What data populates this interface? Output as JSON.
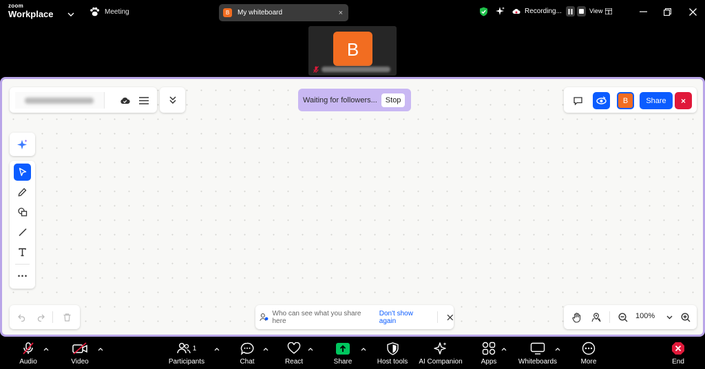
{
  "titlebar": {
    "logo_small": "zoom",
    "logo_main": "Workplace",
    "meeting_label": "Meeting",
    "whiteboard_tab": {
      "avatar": "B",
      "title": "My whiteboard",
      "close": "×"
    },
    "recording_label": "Recording...",
    "view_label": "View"
  },
  "video_tile": {
    "avatar_letter": "B"
  },
  "whiteboard": {
    "follow_status": "Waiting for followers...",
    "stop_label": "Stop",
    "share_label": "Share",
    "close_label": "×",
    "user_avatar": "B",
    "notice_text": "Who can see what you share here",
    "notice_link": "Don't show again",
    "zoom_level": "100%"
  },
  "toolbar": {
    "audio": "Audio",
    "video": "Video",
    "participants": "Participants",
    "participants_count": "1",
    "chat": "Chat",
    "react": "React",
    "share": "Share",
    "host_tools": "Host tools",
    "ai_companion": "AI Companion",
    "apps": "Apps",
    "whiteboards": "Whiteboards",
    "more": "More",
    "end": "End"
  },
  "colors": {
    "accent": "#0b5cff",
    "avatar_orange": "#f26d21",
    "follow_bar": "#c9b8f3",
    "frame_border": "#b9a5e8",
    "end_red": "#e0193a",
    "share_green": "#00c65e"
  }
}
